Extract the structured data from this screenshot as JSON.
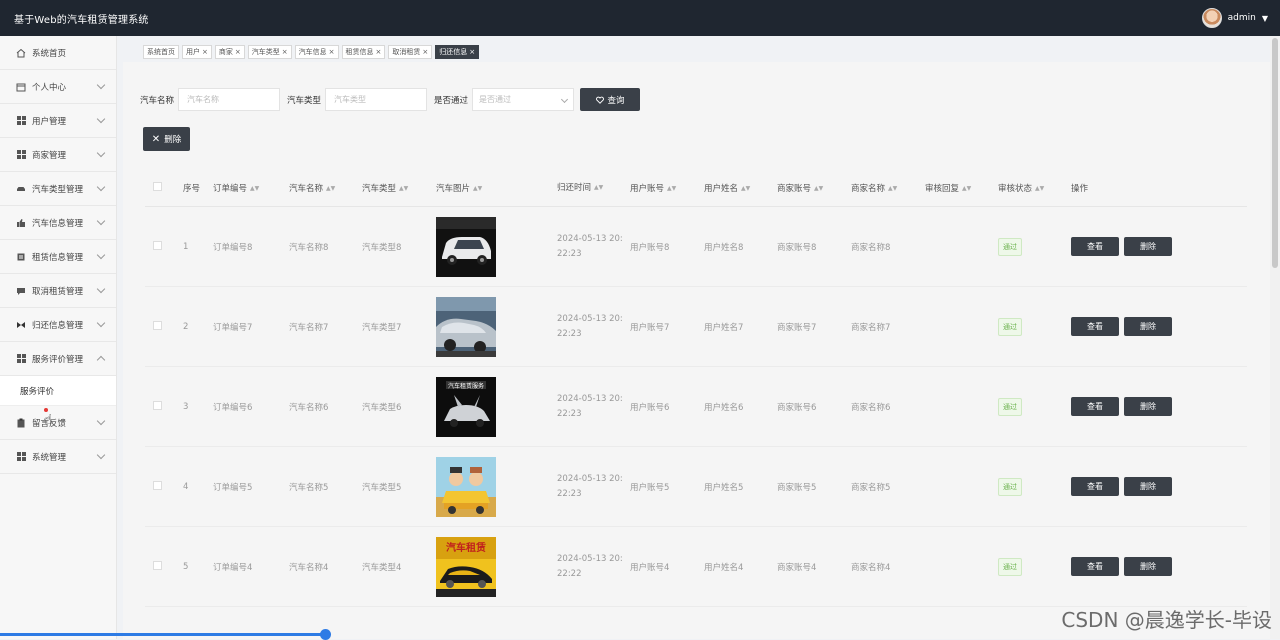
{
  "header": {
    "title": "基于Web的汽车租赁管理系统",
    "user": "admin"
  },
  "sidebar": {
    "items": [
      {
        "label": "系统首页",
        "icon": "home-icon"
      },
      {
        "label": "个人中心",
        "icon": "calendar-icon",
        "expandable": true
      },
      {
        "label": "用户管理",
        "icon": "grid-icon",
        "expandable": true
      },
      {
        "label": "商家管理",
        "icon": "grid-icon",
        "expandable": true
      },
      {
        "label": "汽车类型管理",
        "icon": "car-icon",
        "expandable": true
      },
      {
        "label": "汽车信息管理",
        "icon": "thumb-icon",
        "expandable": true
      },
      {
        "label": "租赁信息管理",
        "icon": "list-icon",
        "expandable": true
      },
      {
        "label": "取消租赁管理",
        "icon": "message-icon",
        "expandable": true
      },
      {
        "label": "归还信息管理",
        "icon": "bow-icon",
        "expandable": true
      },
      {
        "label": "服务评价管理",
        "icon": "grid-icon",
        "expandable": true,
        "expanded": true
      },
      {
        "label": "留言反馈",
        "icon": "clipboard-icon",
        "expandable": true
      },
      {
        "label": "系统管理",
        "icon": "grid-icon",
        "expandable": true
      }
    ],
    "submenu_label": "服务评价"
  },
  "tabs": [
    {
      "label": "系统首页",
      "closable": false
    },
    {
      "label": "用户",
      "closable": true
    },
    {
      "label": "商家",
      "closable": true
    },
    {
      "label": "汽车类型",
      "closable": true
    },
    {
      "label": "汽车信息",
      "closable": true
    },
    {
      "label": "租赁信息",
      "closable": true
    },
    {
      "label": "取消租赁",
      "closable": true
    },
    {
      "label": "归还信息",
      "closable": true,
      "active": true
    }
  ],
  "filters": {
    "car_name_label": "汽车名称",
    "car_name_placeholder": "汽车名称",
    "car_type_label": "汽车类型",
    "car_type_placeholder": "汽车类型",
    "approved_label": "是否通过",
    "approved_placeholder": "是否通过",
    "search_label": "查询",
    "delete_label": "删除"
  },
  "table": {
    "columns": [
      "序号",
      "订单编号",
      "汽车名称",
      "汽车类型",
      "汽车图片",
      "归还时间",
      "用户账号",
      "用户姓名",
      "商家账号",
      "商家名称",
      "审核回复",
      "审核状态",
      "操作"
    ],
    "view_label": "查看",
    "delete_label": "删除",
    "rows": [
      {
        "idx": "1",
        "order": "订单编号8",
        "name": "汽车名称8",
        "type": "汽车类型8",
        "time1": "2024-05-13 20:",
        "time2": "22:23",
        "acc": "用户账号8",
        "uname": "用户姓名8",
        "bacc": "商家账号8",
        "bname": "商家名称8",
        "reply": "",
        "status": "通过",
        "img": "white-van"
      },
      {
        "idx": "2",
        "order": "订单编号7",
        "name": "汽车名称7",
        "type": "汽车类型7",
        "time1": "2024-05-13 20:",
        "time2": "22:23",
        "acc": "用户账号7",
        "uname": "用户姓名7",
        "bacc": "商家账号7",
        "bname": "商家名称7",
        "reply": "",
        "status": "通过",
        "img": "parked-cars"
      },
      {
        "idx": "3",
        "order": "订单编号6",
        "name": "汽车名称6",
        "type": "汽车类型6",
        "time1": "2024-05-13 20:",
        "time2": "22:23",
        "acc": "用户账号6",
        "uname": "用户姓名6",
        "bacc": "商家账号6",
        "bname": "商家名称6",
        "reply": "",
        "status": "通过",
        "img": "rental-poster"
      },
      {
        "idx": "4",
        "order": "订单编号5",
        "name": "汽车名称5",
        "type": "汽车类型5",
        "time1": "2024-05-13 20:",
        "time2": "22:23",
        "acc": "用户账号5",
        "uname": "用户姓名5",
        "bacc": "商家账号5",
        "bname": "商家名称5",
        "reply": "",
        "status": "通过",
        "img": "cartoon"
      },
      {
        "idx": "5",
        "order": "订单编号4",
        "name": "汽车名称4",
        "type": "汽车类型4",
        "time1": "2024-05-13 20:",
        "time2": "22:22",
        "acc": "用户账号4",
        "uname": "用户姓名4",
        "bacc": "商家账号4",
        "bname": "商家名称4",
        "reply": "",
        "status": "通过",
        "img": "yellow-poster"
      }
    ]
  },
  "watermark": "CSDN @晨逸学长-毕设",
  "colors": {
    "header_bg": "#1f2630",
    "button_dark": "#3a4048",
    "status_green": "#6bb24d",
    "accent_blue": "#2d7be5"
  }
}
